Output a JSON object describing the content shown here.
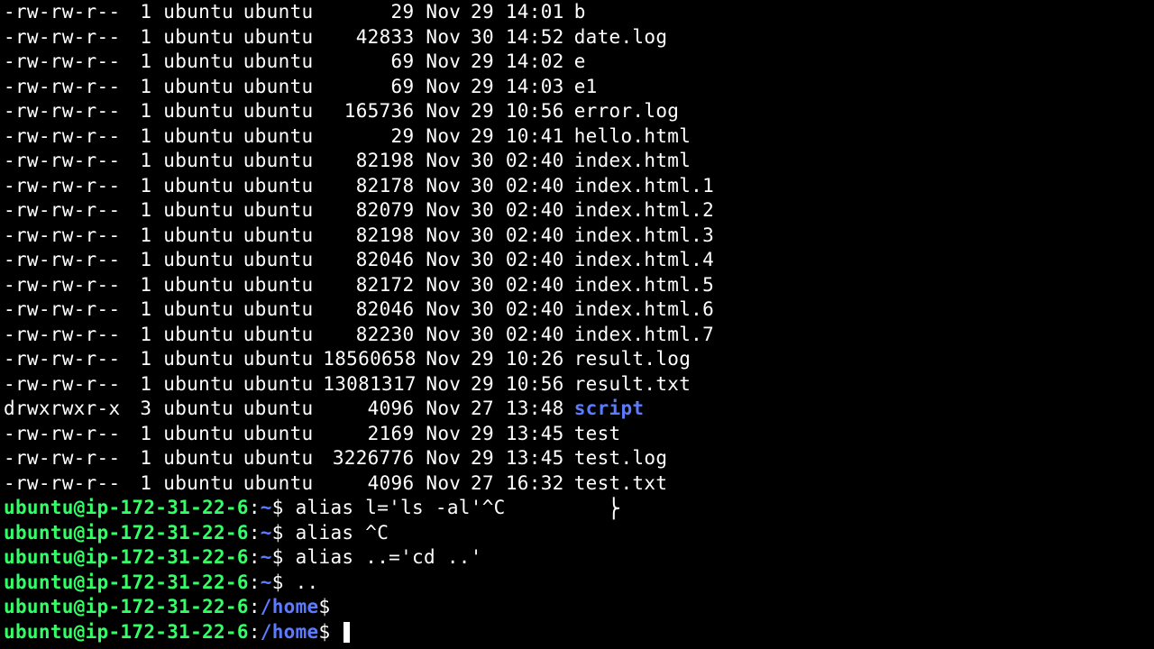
{
  "listing": [
    {
      "perm": "-rw-rw-r--",
      "links": "1",
      "owner": "ubuntu",
      "group": "ubuntu",
      "size": "29",
      "month": "Nov",
      "day": "29",
      "time": "14:01",
      "name": "b",
      "type": "file"
    },
    {
      "perm": "-rw-rw-r--",
      "links": "1",
      "owner": "ubuntu",
      "group": "ubuntu",
      "size": "42833",
      "month": "Nov",
      "day": "30",
      "time": "14:52",
      "name": "date.log",
      "type": "file"
    },
    {
      "perm": "-rw-rw-r--",
      "links": "1",
      "owner": "ubuntu",
      "group": "ubuntu",
      "size": "69",
      "month": "Nov",
      "day": "29",
      "time": "14:02",
      "name": "e",
      "type": "file"
    },
    {
      "perm": "-rw-rw-r--",
      "links": "1",
      "owner": "ubuntu",
      "group": "ubuntu",
      "size": "69",
      "month": "Nov",
      "day": "29",
      "time": "14:03",
      "name": "e1",
      "type": "file"
    },
    {
      "perm": "-rw-rw-r--",
      "links": "1",
      "owner": "ubuntu",
      "group": "ubuntu",
      "size": "165736",
      "month": "Nov",
      "day": "29",
      "time": "10:56",
      "name": "error.log",
      "type": "file"
    },
    {
      "perm": "-rw-rw-r--",
      "links": "1",
      "owner": "ubuntu",
      "group": "ubuntu",
      "size": "29",
      "month": "Nov",
      "day": "29",
      "time": "10:41",
      "name": "hello.html",
      "type": "file"
    },
    {
      "perm": "-rw-rw-r--",
      "links": "1",
      "owner": "ubuntu",
      "group": "ubuntu",
      "size": "82198",
      "month": "Nov",
      "day": "30",
      "time": "02:40",
      "name": "index.html",
      "type": "file"
    },
    {
      "perm": "-rw-rw-r--",
      "links": "1",
      "owner": "ubuntu",
      "group": "ubuntu",
      "size": "82178",
      "month": "Nov",
      "day": "30",
      "time": "02:40",
      "name": "index.html.1",
      "type": "file"
    },
    {
      "perm": "-rw-rw-r--",
      "links": "1",
      "owner": "ubuntu",
      "group": "ubuntu",
      "size": "82079",
      "month": "Nov",
      "day": "30",
      "time": "02:40",
      "name": "index.html.2",
      "type": "file"
    },
    {
      "perm": "-rw-rw-r--",
      "links": "1",
      "owner": "ubuntu",
      "group": "ubuntu",
      "size": "82198",
      "month": "Nov",
      "day": "30",
      "time": "02:40",
      "name": "index.html.3",
      "type": "file"
    },
    {
      "perm": "-rw-rw-r--",
      "links": "1",
      "owner": "ubuntu",
      "group": "ubuntu",
      "size": "82046",
      "month": "Nov",
      "day": "30",
      "time": "02:40",
      "name": "index.html.4",
      "type": "file"
    },
    {
      "perm": "-rw-rw-r--",
      "links": "1",
      "owner": "ubuntu",
      "group": "ubuntu",
      "size": "82172",
      "month": "Nov",
      "day": "30",
      "time": "02:40",
      "name": "index.html.5",
      "type": "file"
    },
    {
      "perm": "-rw-rw-r--",
      "links": "1",
      "owner": "ubuntu",
      "group": "ubuntu",
      "size": "82046",
      "month": "Nov",
      "day": "30",
      "time": "02:40",
      "name": "index.html.6",
      "type": "file"
    },
    {
      "perm": "-rw-rw-r--",
      "links": "1",
      "owner": "ubuntu",
      "group": "ubuntu",
      "size": "82230",
      "month": "Nov",
      "day": "30",
      "time": "02:40",
      "name": "index.html.7",
      "type": "file"
    },
    {
      "perm": "-rw-rw-r--",
      "links": "1",
      "owner": "ubuntu",
      "group": "ubuntu",
      "size": "18560658",
      "month": "Nov",
      "day": "29",
      "time": "10:26",
      "name": "result.log",
      "type": "file"
    },
    {
      "perm": "-rw-rw-r--",
      "links": "1",
      "owner": "ubuntu",
      "group": "ubuntu",
      "size": "13081317",
      "month": "Nov",
      "day": "29",
      "time": "10:56",
      "name": "result.txt",
      "type": "file"
    },
    {
      "perm": "drwxrwxr-x",
      "links": "3",
      "owner": "ubuntu",
      "group": "ubuntu",
      "size": "4096",
      "month": "Nov",
      "day": "27",
      "time": "13:48",
      "name": "script",
      "type": "dir"
    },
    {
      "perm": "-rw-rw-r--",
      "links": "1",
      "owner": "ubuntu",
      "group": "ubuntu",
      "size": "2169",
      "month": "Nov",
      "day": "29",
      "time": "13:45",
      "name": "test",
      "type": "file"
    },
    {
      "perm": "-rw-rw-r--",
      "links": "1",
      "owner": "ubuntu",
      "group": "ubuntu",
      "size": "3226776",
      "month": "Nov",
      "day": "29",
      "time": "13:45",
      "name": "test.log",
      "type": "file"
    },
    {
      "perm": "-rw-rw-r--",
      "links": "1",
      "owner": "ubuntu",
      "group": "ubuntu",
      "size": "4096",
      "month": "Nov",
      "day": "27",
      "time": "16:32",
      "name": "test.txt",
      "type": "file"
    }
  ],
  "prompts": [
    {
      "userhost": "ubuntu@ip-172-31-22-6",
      "path": "~",
      "cmd": "alias l='ls -al'^C",
      "extra_text_cursor": true
    },
    {
      "userhost": "ubuntu@ip-172-31-22-6",
      "path": "~",
      "cmd": "alias ^C"
    },
    {
      "userhost": "ubuntu@ip-172-31-22-6",
      "path": "~",
      "cmd": "alias ..='cd ..'"
    },
    {
      "userhost": "ubuntu@ip-172-31-22-6",
      "path": "~",
      "cmd": ".."
    },
    {
      "userhost": "ubuntu@ip-172-31-22-6",
      "path": "/home",
      "cmd": ""
    },
    {
      "userhost": "ubuntu@ip-172-31-22-6",
      "path": "/home",
      "cmd": "",
      "cursor": true
    }
  ],
  "text_cursor_glyph": "⎬"
}
